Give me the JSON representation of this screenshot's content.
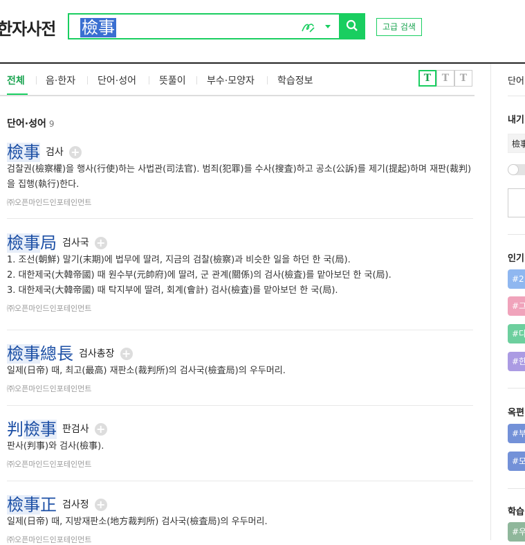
{
  "header": {
    "logo": "한자사전",
    "search_value": "檢事",
    "advanced_label": "고급 검색"
  },
  "tabs": [
    {
      "label": "전체",
      "active": true
    },
    {
      "label": "음·한자"
    },
    {
      "label": "단어·성어"
    },
    {
      "label": "뜻풀이"
    },
    {
      "label": "부수·모양자"
    },
    {
      "label": "학습정보"
    }
  ],
  "font_buttons": [
    "T",
    "T",
    "T"
  ],
  "section": {
    "title": "단어·성어",
    "count": "9"
  },
  "entries": [
    {
      "hanja_hl": "檢事",
      "hanja_rest": "",
      "hanja_pre": "",
      "reading": "검사",
      "defs": [
        "검찰권(檢察權)을 행사(行使)하는 사법관(司法官). 범죄(犯罪)를 수사(搜査)하고 공소(公訴)를 제기(提起)하며 재판(裁判)을 집행(執行)한다."
      ],
      "source": "㈜오픈마인드인포테인먼트"
    },
    {
      "hanja_hl": "檢事",
      "hanja_rest": "局",
      "hanja_pre": "",
      "reading": "검사국",
      "defs": [
        "1. 조선(朝鮮) 말기(末期)에 법무에 딸려, 지금의 검찰(檢察)과 비슷한 일을 하던 한 국(局).",
        "2. 대한제국(大韓帝國) 때 원수부(元帥府)에 딸려, 군 관계(關係)의 검사(檢査)를 맡아보던 한 국(局).",
        "3. 대한제국(大韓帝國) 때 탁지부에 딸려, 회계(會計) 검사(檢査)를 맡아보던 한 국(局)."
      ],
      "source": "㈜오픈마인드인포테인먼트"
    },
    {
      "hanja_hl": "檢事",
      "hanja_rest": "總長",
      "hanja_pre": "",
      "reading": "검사총장",
      "defs": [
        "일제(日帝) 때, 최고(最高) 재판소(裁判所)의 검사국(檢査局)의 우두머리."
      ],
      "source": "㈜오픈마인드인포테인먼트"
    },
    {
      "hanja_hl": "檢事",
      "hanja_rest": "",
      "hanja_pre": "判",
      "reading": "판검사",
      "defs": [
        "판사(判事)와 검사(檢事)."
      ],
      "source": "㈜오픈마인드인포테인먼트"
    },
    {
      "hanja_hl": "檢事",
      "hanja_rest": "正",
      "hanja_pre": "",
      "reading": "검사정",
      "defs": [
        "일제(日帝) 때, 지방재판소(地方裁判所) 검사국(檢査局)의 우두머리."
      ],
      "source": "㈜오픈마인드인포테인먼트"
    }
  ],
  "right": {
    "t1": "단어",
    "t2": "내기",
    "t3": "檢事",
    "t4": "인기",
    "t5": "옥편",
    "t6": "학습",
    "tags": [
      "#2",
      "#그",
      "#다",
      "#한"
    ],
    "tags2": [
      "#부",
      "#모"
    ],
    "tag3": "#우"
  },
  "colors": {
    "accent": "#19ce60",
    "hanja": "#1c4fa5",
    "tag_blue": "#8fb7f0",
    "tag_pink": "#f0a3bb",
    "tag_green": "#6dcf9e",
    "tag_purple": "#ab9be3",
    "tag_navy": "#7391d8",
    "tag_sage": "#8fb79b"
  }
}
